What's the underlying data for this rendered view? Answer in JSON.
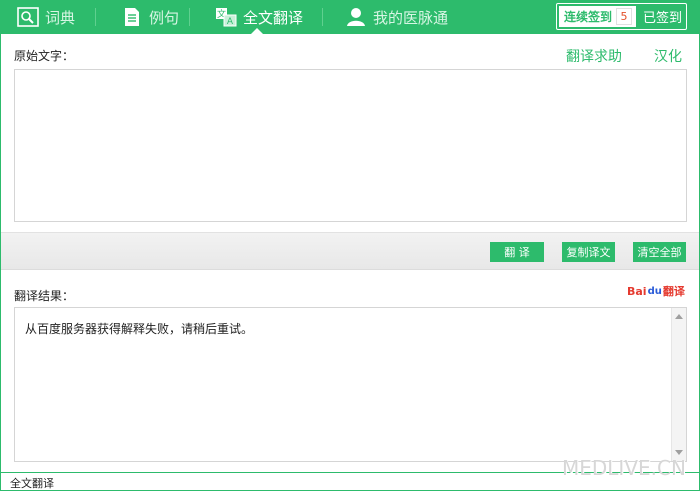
{
  "nav": {
    "tabs": [
      {
        "label": "词典",
        "icon": "dictionary-search-icon"
      },
      {
        "label": "例句",
        "icon": "document-icon"
      },
      {
        "label": "全文翻译",
        "icon": "translate-icon",
        "active": true
      },
      {
        "label": "我的医脉通",
        "icon": "user-icon"
      }
    ],
    "signin": {
      "label": "连续签到",
      "count": "5",
      "status": "已签到"
    }
  },
  "source": {
    "label": "原始文字：",
    "help_link": "翻译求助",
    "localize_link": "汉化",
    "value": ""
  },
  "actions": {
    "translate": "翻 译",
    "copy": "复制译文",
    "clear": "清空全部"
  },
  "result": {
    "label": "翻译结果：",
    "provider_logo": {
      "left": "Bai",
      "mark": "du",
      "right": "翻译"
    },
    "text": "从百度服务器获得解释失败，请稍后重试。"
  },
  "status": {
    "text": "全文翻译"
  },
  "watermark": "MEDLIVE.CN",
  "colors": {
    "accent": "#2dbb6c",
    "count": "#e4502a"
  }
}
